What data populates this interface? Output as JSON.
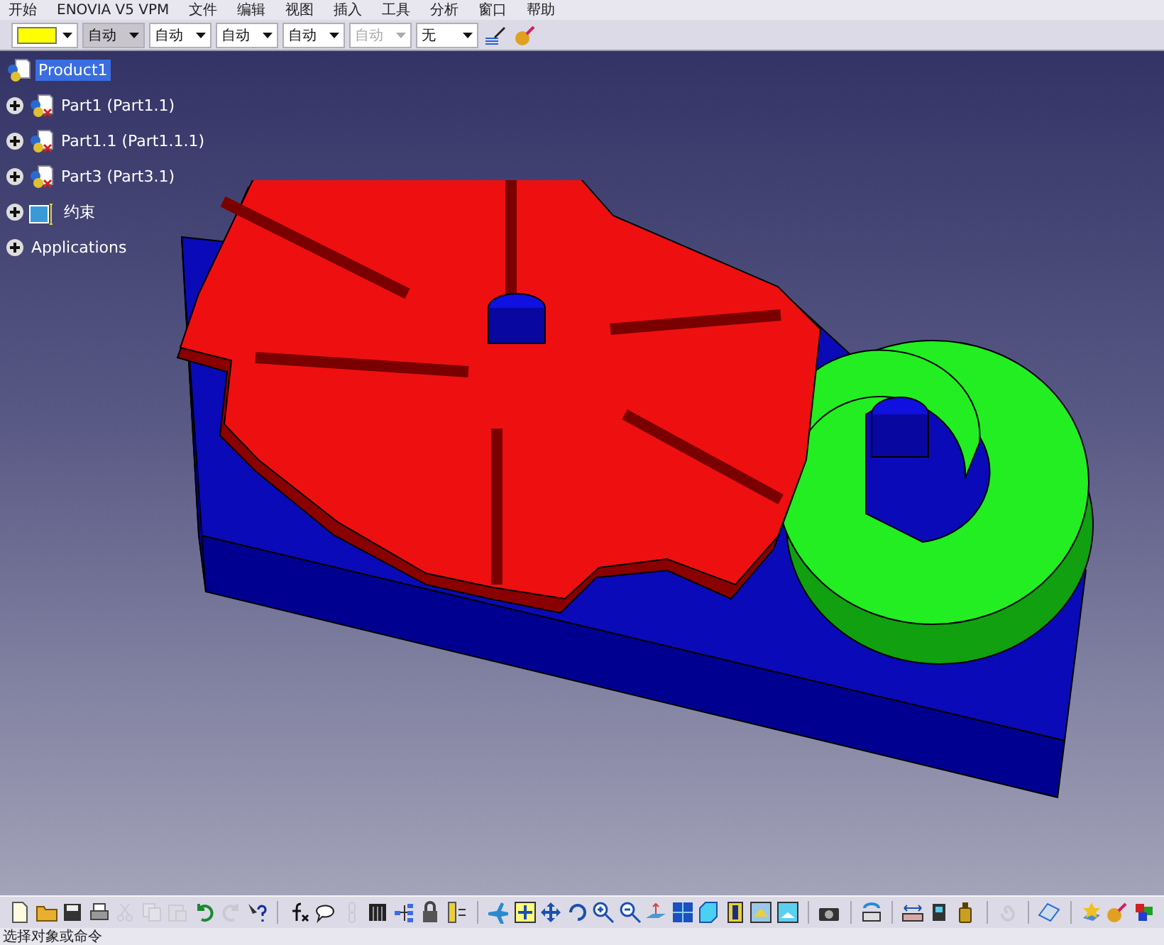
{
  "menu_bar": [
    "开始",
    "ENOVIA V5 VPM",
    "文件",
    "编辑",
    "视图",
    "插入",
    "工具",
    "分析",
    "窗口",
    "帮助"
  ],
  "properties_toolbar": {
    "dropdowns": [
      {
        "kind": "color",
        "color": "#ffff00",
        "pressed": false,
        "disabled": false
      },
      {
        "kind": "text",
        "value": "自动",
        "pressed": true,
        "disabled": false
      },
      {
        "kind": "text",
        "value": "自动",
        "pressed": false,
        "disabled": false
      },
      {
        "kind": "text",
        "value": "自动",
        "pressed": false,
        "disabled": false
      },
      {
        "kind": "text",
        "value": "自动",
        "pressed": false,
        "disabled": false
      },
      {
        "kind": "text",
        "value": "自动",
        "pressed": false,
        "disabled": true
      },
      {
        "kind": "text",
        "value": "无",
        "pressed": false,
        "disabled": false
      }
    ],
    "tools": [
      {
        "kind": "brush",
        "disabled": false
      },
      {
        "kind": "sphere",
        "disabled": false
      }
    ]
  },
  "tree": {
    "root": {
      "label": "Product1",
      "selected": true
    },
    "nodes": [
      {
        "kind": "part",
        "label": "Part1 (Part1.1)",
        "expanded": false
      },
      {
        "kind": "part",
        "label": "Part1.1 (Part1.1.1)",
        "expanded": false
      },
      {
        "kind": "part",
        "label": "Part3 (Part3.1)",
        "expanded": false
      },
      {
        "kind": "constraints",
        "label": "约束",
        "expanded": false
      },
      {
        "kind": "applications",
        "label": "Applications",
        "expanded": false
      }
    ]
  },
  "bottom_toolbar": [
    [
      {
        "kind": "new",
        "disabled": false
      },
      {
        "kind": "open",
        "disabled": false
      },
      {
        "kind": "save",
        "disabled": false
      },
      {
        "kind": "print",
        "disabled": false
      },
      {
        "kind": "cut",
        "disabled": true
      },
      {
        "kind": "copy",
        "disabled": true
      },
      {
        "kind": "paste",
        "disabled": true
      },
      {
        "kind": "undo",
        "disabled": false
      },
      {
        "kind": "redo",
        "disabled": true
      },
      {
        "kind": "help",
        "disabled": false
      }
    ],
    [
      {
        "kind": "formula",
        "disabled": false
      },
      {
        "kind": "comment",
        "disabled": false
      },
      {
        "kind": "link",
        "disabled": true
      },
      {
        "kind": "table",
        "disabled": false
      },
      {
        "kind": "nodes",
        "disabled": false
      },
      {
        "kind": "lock",
        "disabled": false
      },
      {
        "kind": "hierarchy",
        "disabled": false
      }
    ],
    [
      {
        "kind": "fly",
        "disabled": false
      },
      {
        "kind": "fit",
        "disabled": false
      },
      {
        "kind": "pan",
        "disabled": false
      },
      {
        "kind": "rotate",
        "disabled": false
      },
      {
        "kind": "zoomin",
        "disabled": false
      },
      {
        "kind": "zoomout",
        "disabled": false
      },
      {
        "kind": "normal",
        "disabled": false
      },
      {
        "kind": "views",
        "disabled": false
      },
      {
        "kind": "cube",
        "disabled": false
      },
      {
        "kind": "shading",
        "disabled": false
      },
      {
        "kind": "hide",
        "disabled": false
      },
      {
        "kind": "swap",
        "disabled": false
      }
    ],
    [
      {
        "kind": "camera",
        "disabled": false
      }
    ],
    [
      {
        "kind": "boxrotate",
        "disabled": false
      }
    ],
    [
      {
        "kind": "measure",
        "disabled": false
      },
      {
        "kind": "measureitem",
        "disabled": false
      },
      {
        "kind": "weight",
        "disabled": false
      }
    ],
    [
      {
        "kind": "swirl",
        "disabled": true
      }
    ],
    [
      {
        "kind": "plane",
        "disabled": false
      }
    ],
    [
      {
        "kind": "render",
        "disabled": false
      },
      {
        "kind": "sphere",
        "disabled": false
      },
      {
        "kind": "colorcube",
        "disabled": false
      }
    ]
  ],
  "status_bar": {
    "message": "选择对象或命令"
  }
}
